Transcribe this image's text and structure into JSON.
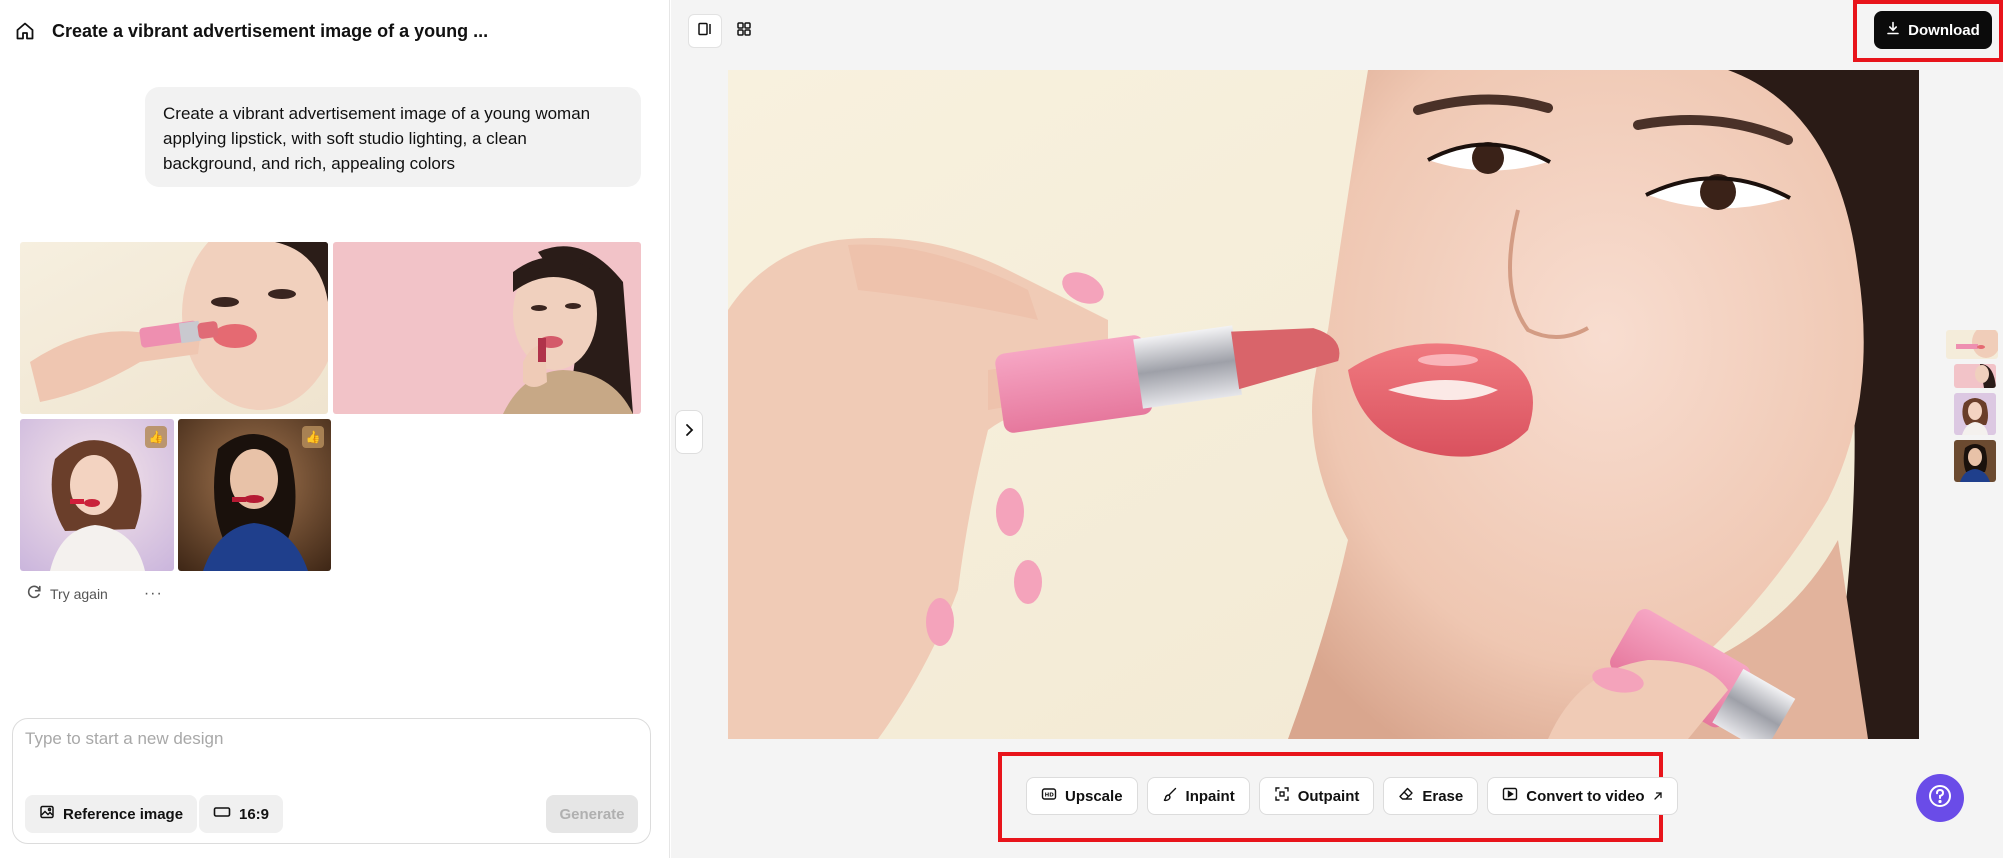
{
  "header": {
    "title": "Create a vibrant advertisement image of a young ..."
  },
  "prompt": {
    "text": "Create a vibrant advertisement image of a young woman applying lipstick, with soft studio lighting, a clean background, and rich, appealing colors"
  },
  "results": {
    "try_again_label": "Try again",
    "more_label": "···"
  },
  "composer": {
    "placeholder": "Type to start a new design",
    "reference_label": "Reference image",
    "ratio_label": "16:9",
    "generate_label": "Generate"
  },
  "toolbar": {
    "download_label": "Download"
  },
  "tools": [
    {
      "label": "Upscale",
      "icon": "upscale-icon"
    },
    {
      "label": "Inpaint",
      "icon": "brush-icon"
    },
    {
      "label": "Outpaint",
      "icon": "expand-icon"
    },
    {
      "label": "Erase",
      "icon": "eraser-icon"
    },
    {
      "label": "Convert to video",
      "icon": "video-icon"
    }
  ],
  "colors": {
    "accent": "#6a4ce8",
    "highlight": "#e8141b",
    "primary_button": "#0b0b0b"
  }
}
